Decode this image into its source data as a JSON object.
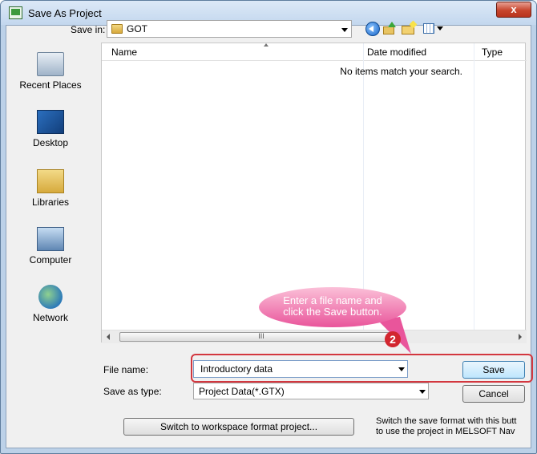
{
  "window": {
    "title": "Save As Project",
    "close_symbol": "x"
  },
  "save_in": {
    "label": "Save in:",
    "value": "GOT"
  },
  "toolbar": {
    "icons": [
      "back-icon",
      "up-folder-icon",
      "new-folder-icon",
      "views-menu-icon"
    ]
  },
  "places": [
    {
      "label": "Recent Places",
      "icon": "recent-places-icon"
    },
    {
      "label": "Desktop",
      "icon": "desktop-icon"
    },
    {
      "label": "Libraries",
      "icon": "libraries-icon"
    },
    {
      "label": "Computer",
      "icon": "computer-icon"
    },
    {
      "label": "Network",
      "icon": "network-icon"
    }
  ],
  "file_list": {
    "columns": [
      "Name",
      "Date modified",
      "Type"
    ],
    "empty_message": "No items match your search.",
    "scroll_thumb": "III"
  },
  "file_name": {
    "label": "File name:",
    "value": "Introductory data"
  },
  "save_as_type": {
    "label": "Save as type:",
    "value": "Project Data(*.GTX)"
  },
  "buttons": {
    "save": "Save",
    "cancel": "Cancel",
    "switch": "Switch to workspace format project..."
  },
  "switch_note": {
    "line1": "Switch the save format with this butt",
    "line2": "to use the project in MELSOFT Nav"
  },
  "annotation": {
    "line1": "Enter a file name and",
    "line2": "click the Save button.",
    "step": "2",
    "color": "#d2262f"
  }
}
